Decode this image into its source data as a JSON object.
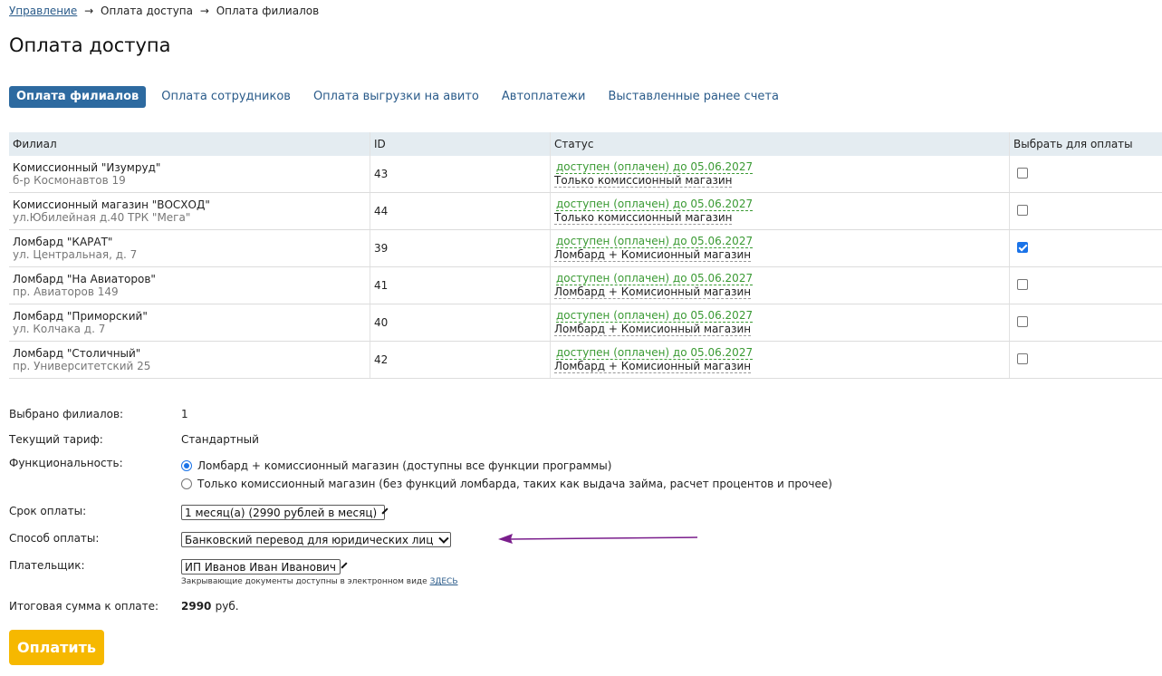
{
  "breadcrumb": {
    "items": [
      "Управление",
      "Оплата доступа",
      "Оплата филиалов"
    ],
    "separator": "→"
  },
  "page_title": "Оплата доступа",
  "tabs": [
    {
      "label": "Оплата филиалов",
      "active": true
    },
    {
      "label": "Оплата сотрудников",
      "active": false
    },
    {
      "label": "Оплата выгрузки на авито",
      "active": false
    },
    {
      "label": "Автоплатежи",
      "active": false
    },
    {
      "label": "Выставленные ранее счета",
      "active": false
    }
  ],
  "table": {
    "headers": [
      "Филиал",
      "ID",
      "Статус",
      "Выбрать для оплаты"
    ],
    "rows": [
      {
        "name": "Комиссионный \"Изумруд\"",
        "address": "б-р Космонавтов 19",
        "id": "43",
        "status": "доступен (оплачен) до 05.06.2027",
        "type": "Только комиссионный магазин",
        "selected": false
      },
      {
        "name": "Комиссионный магазин \"ВОСХОД\"",
        "address": "ул.Юбилейная д.40 ТРК \"Мега\"",
        "id": "44",
        "status": "доступен (оплачен) до 05.06.2027",
        "type": "Только комиссионный магазин",
        "selected": false
      },
      {
        "name": "Ломбард \"КАРАТ\"",
        "address": "ул. Центральная, д. 7",
        "id": "39",
        "status": "доступен (оплачен) до 05.06.2027",
        "type": "Ломбард + Комисионный магазин",
        "selected": true
      },
      {
        "name": "Ломбард \"На Авиаторов\"",
        "address": "пр. Авиаторов 149",
        "id": "41",
        "status": "доступен (оплачен) до 05.06.2027",
        "type": "Ломбард + Комисионный магазин",
        "selected": false
      },
      {
        "name": "Ломбард \"Приморский\"",
        "address": "ул. Колчака д. 7",
        "id": "40",
        "status": "доступен (оплачен) до 05.06.2027",
        "type": "Ломбард + Комисионный магазин",
        "selected": false
      },
      {
        "name": "Ломбард \"Столичный\"",
        "address": "пр. Университетский 25",
        "id": "42",
        "status": "доступен (оплачен) до 05.06.2027",
        "type": "Ломбард + Комисионный магазин",
        "selected": false
      }
    ]
  },
  "form": {
    "selected_count_label": "Выбрано филиалов:",
    "selected_count": "1",
    "tariff_label": "Текущий тариф:",
    "tariff": "Стандартный",
    "functionality_label": "Функциональность:",
    "functionality_options": [
      {
        "label": "Ломбард + комиссионный магазин (доступны все функции программы)",
        "checked": true
      },
      {
        "label": "Только комиссионный магазин (без функций ломбарда, таких как выдача займа, расчет процентов и прочее)",
        "checked": false
      }
    ],
    "term_label": "Срок оплаты:",
    "term_value": "1 месяц(а) (2990 рублей в месяц)",
    "method_label": "Способ оплаты:",
    "method_value": "Банковский перевод для юридических лиц",
    "payer_label": "Плательщик:",
    "payer_value": "ИП Иванов Иван Иванович",
    "docs_note": "Закрывающие документы доступны в электронном виде",
    "docs_link": "ЗДЕСЬ",
    "total_label": "Итоговая сумма к оплате:",
    "total_amount": "2990",
    "total_unit": "руб."
  },
  "pay_button": "Оплатить",
  "colors": {
    "accent": "#2d6aa0",
    "link": "#2a5b8a",
    "status_green": "#3a9a33",
    "pay_button": "#f6b800",
    "arrow": "#7a1e8c"
  }
}
